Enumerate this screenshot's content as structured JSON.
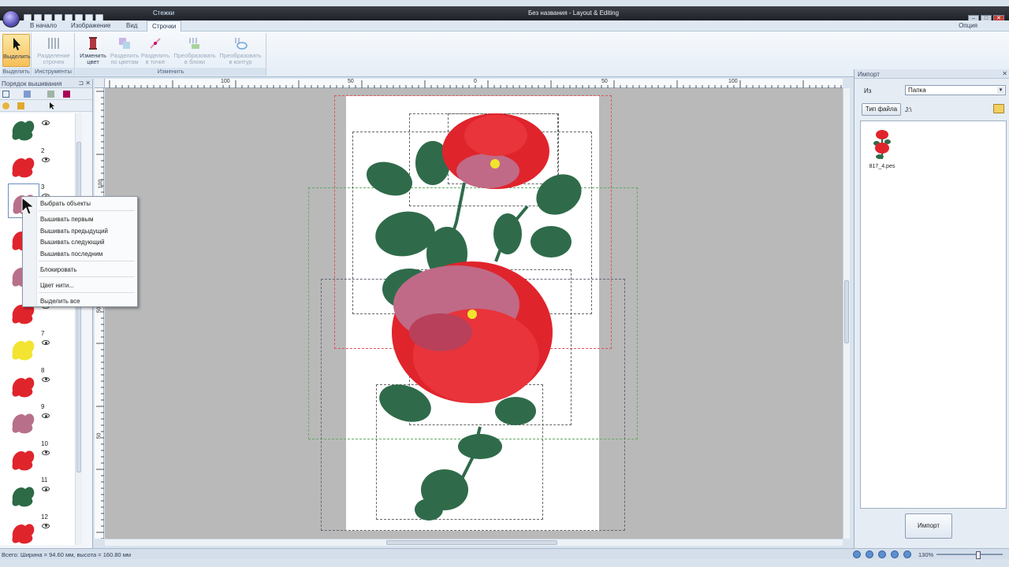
{
  "titlebar": {
    "title": "Без названия - Layout & Editing",
    "context_tab_title": "Стежки"
  },
  "menu": {
    "tabs": [
      "В начало",
      "Изображение",
      "Вид",
      "Строчки"
    ],
    "active_tab": "Строчки",
    "options": "Опция"
  },
  "ribbon": {
    "groups": [
      {
        "label": "Выделить",
        "buttons": [
          {
            "label": "Выделить",
            "icon": "arrow-cursor-icon",
            "selected": true
          }
        ]
      },
      {
        "label": "Инструменты",
        "buttons": [
          {
            "label": "Разделение строчек",
            "icon": "split-stitches-icon"
          }
        ]
      },
      {
        "label": "Изменить",
        "buttons": [
          {
            "label": "Изменить цвет",
            "icon": "spool-icon"
          },
          {
            "label": "Разделить по цветам",
            "icon": "split-colors-icon"
          },
          {
            "label": "Разделить в точке",
            "icon": "split-point-icon"
          },
          {
            "label": "Преобразовать в блоки",
            "icon": "convert-blocks-icon"
          },
          {
            "label": "Преобразовать в контур",
            "icon": "convert-outline-icon"
          }
        ]
      }
    ]
  },
  "left_panel": {
    "title": "Порядок вышивания",
    "items": [
      {
        "num": "",
        "color": "#2d6a46"
      },
      {
        "num": "2",
        "color": "#e0242c"
      },
      {
        "num": "3",
        "color": "#b8708a"
      },
      {
        "num": "",
        "color": "#e0242c"
      },
      {
        "num": "",
        "color": "#b8708a"
      },
      {
        "num": "",
        "color": "#e0242c"
      },
      {
        "num": "7",
        "color": "#f2e430"
      },
      {
        "num": "8",
        "color": "#e0242c"
      },
      {
        "num": "9",
        "color": "#b8708a"
      },
      {
        "num": "10",
        "color": "#e0242c"
      },
      {
        "num": "11",
        "color": "#2d6a46"
      },
      {
        "num": "12",
        "color": "#e0242c"
      }
    ]
  },
  "context_menu": {
    "items": [
      "Выбрать объекты",
      "Вышивать первым",
      "Вышивать предыдущий",
      "Вышивать следующий",
      "Вышивать последним",
      "Блокировать",
      "Цвет нити...",
      "Выделить все"
    ]
  },
  "rulers": {
    "top": [
      "100",
      "50",
      "0",
      "50",
      "100"
    ],
    "left": [
      "100",
      "50",
      "0",
      "50"
    ]
  },
  "right_panel": {
    "title": "Импорт",
    "from_label": "Из",
    "from_value": "Папка",
    "filetype_button": "Тип файла",
    "path": "J:\\",
    "file_name": "817_4.pes",
    "import_button": "Импорт"
  },
  "status": {
    "text": "Всего: Ширина = 94.60 мм, высота = 160.80 мм",
    "zoom": "130%"
  },
  "colors": {
    "red": "#e0242c",
    "pink": "#c06a87",
    "green": "#2f6b4a",
    "yellow": "#f0e52c"
  }
}
